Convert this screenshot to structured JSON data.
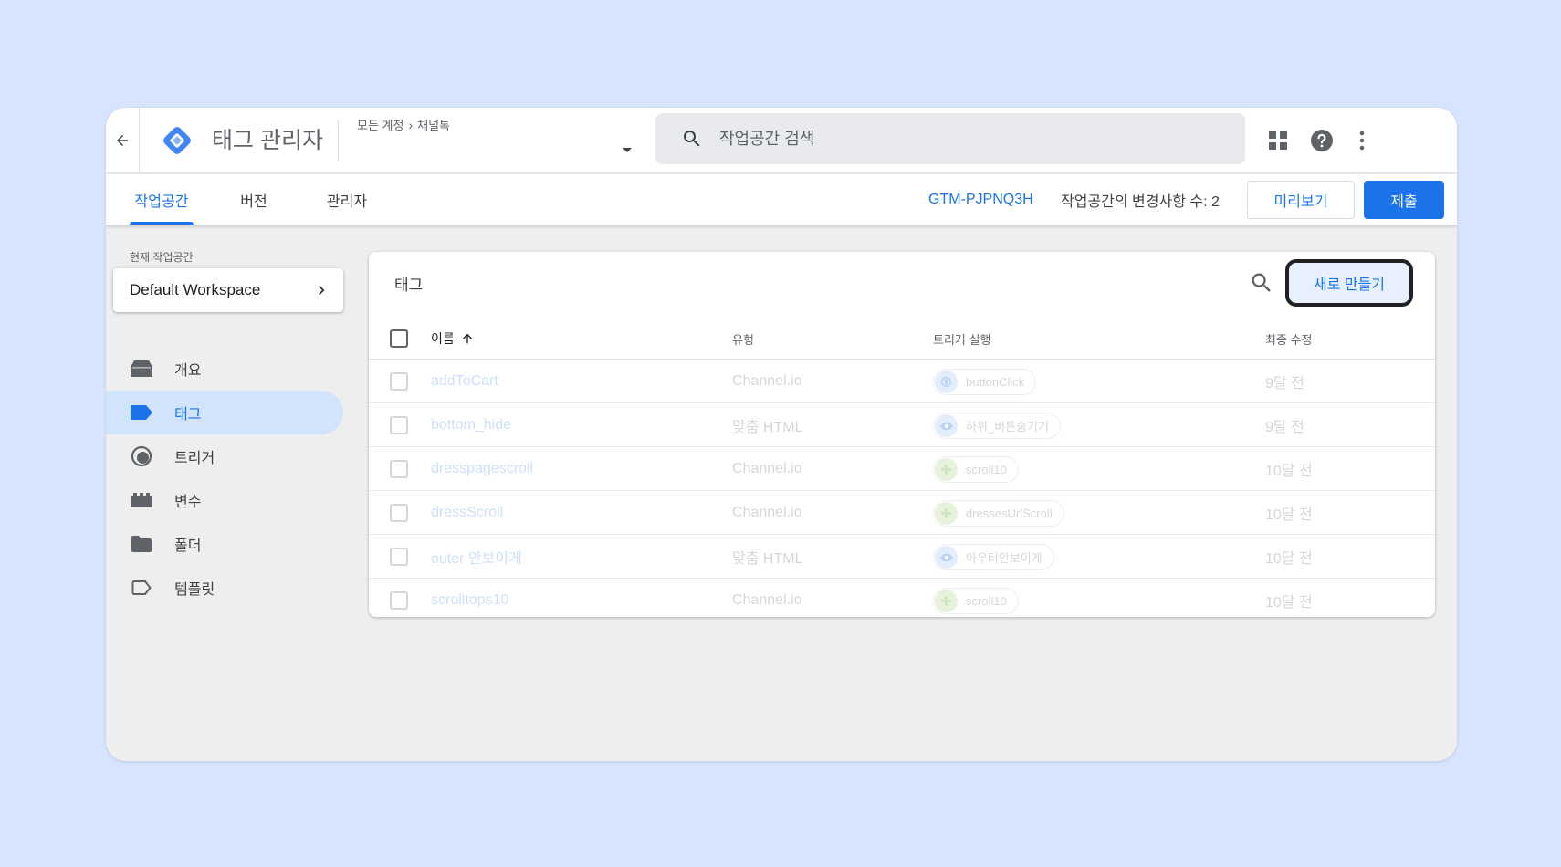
{
  "header": {
    "app_title": "태그 관리자",
    "breadcrumb": {
      "account_label": "모든 계정",
      "container": "채널톡"
    },
    "search": {
      "placeholder": "작업공간 검색"
    }
  },
  "tabs": {
    "items": [
      {
        "label": "작업공간",
        "active": true
      },
      {
        "label": "버전",
        "active": false
      },
      {
        "label": "관리자",
        "active": false
      }
    ],
    "container_id": "GTM-PJPNQ3H",
    "changes_label": "작업공간의 변경사항 수: 2",
    "preview_label": "미리보기",
    "submit_label": "제출"
  },
  "sidebar": {
    "workspace_label": "현재 작업공간",
    "workspace_name": "Default Workspace",
    "items": [
      {
        "label": "개요",
        "icon": "overview-icon",
        "active": false
      },
      {
        "label": "태그",
        "icon": "tag-icon",
        "active": true
      },
      {
        "label": "트리거",
        "icon": "trigger-icon",
        "active": false
      },
      {
        "label": "변수",
        "icon": "variable-icon",
        "active": false
      },
      {
        "label": "폴더",
        "icon": "folder-icon",
        "active": false
      },
      {
        "label": "템플릿",
        "icon": "template-icon",
        "active": false
      }
    ]
  },
  "tags_panel": {
    "title": "태그",
    "new_button_label": "새로 만들기",
    "columns": {
      "name": "이름",
      "type": "유형",
      "trigger": "트리거 실행",
      "modified": "최종 수정"
    },
    "rows": [
      {
        "name": "addToCart",
        "type": "Channel.io",
        "trigger": "buttonClick",
        "trigger_kind": "click",
        "modified": "9달 전"
      },
      {
        "name": "bottom_hide",
        "type": "맞춤 HTML",
        "trigger": "하위_버튼숨기기",
        "trigger_kind": "pageview",
        "modified": "9달 전"
      },
      {
        "name": "dresspagescroll",
        "type": "Channel.io",
        "trigger": "scroll10",
        "trigger_kind": "scroll",
        "modified": "10달 전"
      },
      {
        "name": "dressScroll",
        "type": "Channel.io",
        "trigger": "dressesUrlScroll",
        "trigger_kind": "scroll",
        "modified": "10달 전"
      },
      {
        "name": "outer 안보이게",
        "type": "맞춤 HTML",
        "trigger": "아우터안보이게",
        "trigger_kind": "pageview",
        "modified": "10달 전"
      },
      {
        "name": "scrolltops10",
        "type": "Channel.io",
        "trigger": "scroll10",
        "trigger_kind": "scroll",
        "modified": "10달 전"
      }
    ]
  },
  "colors": {
    "accent": "#1a73e8",
    "active_nav_bg": "#d2e3fc",
    "page_bg": "#d6e4fd"
  }
}
